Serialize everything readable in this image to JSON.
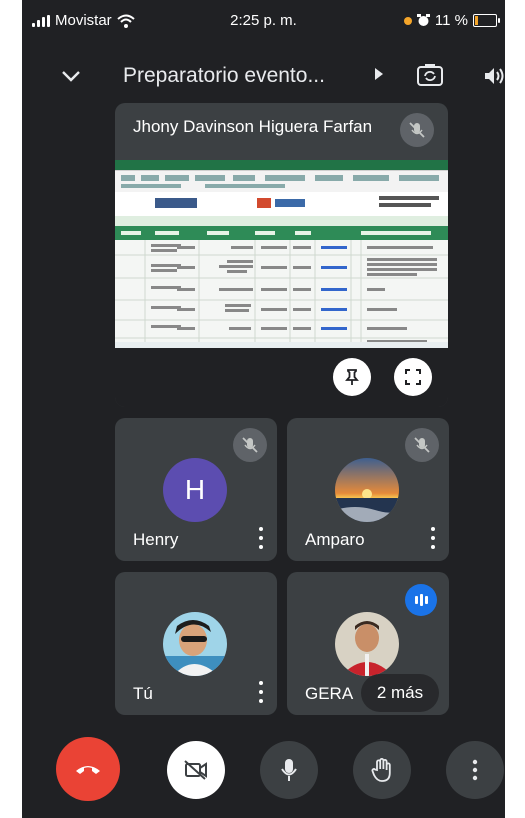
{
  "status_bar": {
    "carrier": "Movistar",
    "time": "2:25 p. m.",
    "battery": "11 %"
  },
  "header": {
    "meeting_title": "Preparatorio evento...",
    "icons": [
      "chevron-down-icon",
      "play-icon",
      "switch-camera-icon",
      "speaker-icon"
    ]
  },
  "presentation": {
    "presenter_name": "Jhony Davinson Higuera Farfan",
    "mic_state": "muted",
    "actions": [
      "pin-icon",
      "fullscreen-icon"
    ]
  },
  "participants": [
    {
      "name": "Henry",
      "avatar_letter": "H",
      "avatar_color": "#5c4db0",
      "mic_state": "muted"
    },
    {
      "name": "Amparo",
      "avatar": "photo",
      "mic_state": "muted"
    },
    {
      "name": "Tú",
      "avatar": "photo"
    },
    {
      "name": "GERA",
      "avatar": "photo",
      "speaking": true
    }
  ],
  "overflow_chip": "2 más",
  "controls": [
    "end-call-icon",
    "camera-off-icon",
    "microphone-icon",
    "raise-hand-icon",
    "more-options-icon"
  ],
  "colors": {
    "background": "#202124",
    "tile": "#3c4043",
    "end_call": "#ea4335",
    "speaking": "#1a73e8",
    "avatar_henry": "#5c4db0"
  }
}
